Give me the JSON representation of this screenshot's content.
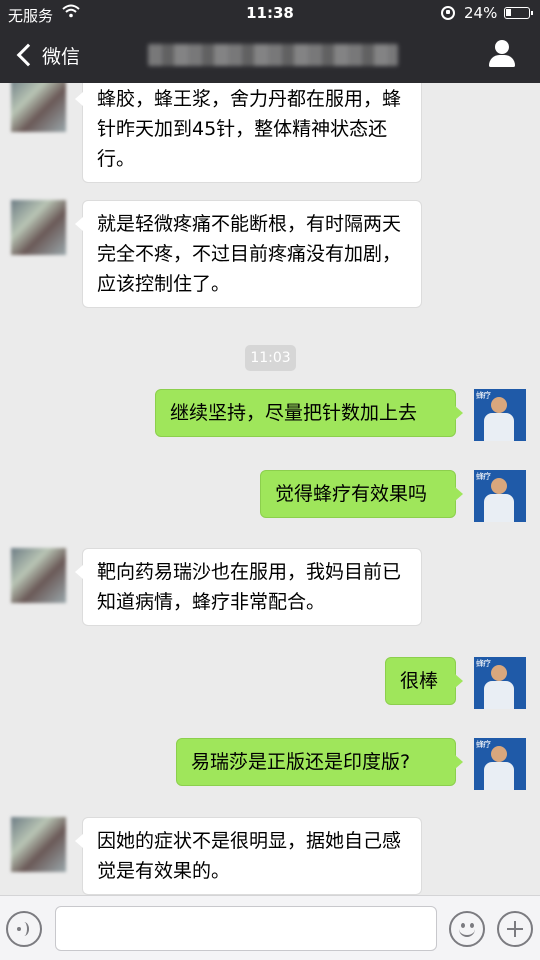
{
  "status_bar": {
    "carrier": "无服务",
    "time": "11:38",
    "battery_text": "24%",
    "battery_level": 0.24
  },
  "nav": {
    "back_label": "微信"
  },
  "chat": {
    "timestamp": "11:03",
    "messages": [
      {
        "side": "left",
        "text": "蜂胶，蜂王浆，舍力丹都在服用，蜂针昨天加到45针，整体精神状态还行。"
      },
      {
        "side": "left",
        "text": "就是轻微疼痛不能断根，有时隔两天完全不疼，不过目前疼痛没有加剧，应该控制住了。"
      },
      {
        "side": "right",
        "text": "继续坚持，尽量把针数加上去"
      },
      {
        "side": "right",
        "text": "觉得蜂疗有效果吗"
      },
      {
        "side": "left",
        "text": "靶向药易瑞沙也在服用，我妈目前已知道病情，蜂疗非常配合。"
      },
      {
        "side": "right",
        "text": "很棒"
      },
      {
        "side": "right",
        "text": "易瑞莎是正版还是印度版?"
      },
      {
        "side": "left",
        "text": "因她的症状不是很明显，据她自己感觉是有效果的。"
      }
    ]
  },
  "colors": {
    "nav_bg": "#2b2b2f",
    "chat_bg": "#ebebeb",
    "bubble_right": "#9fe65b",
    "bubble_left": "#ffffff"
  }
}
